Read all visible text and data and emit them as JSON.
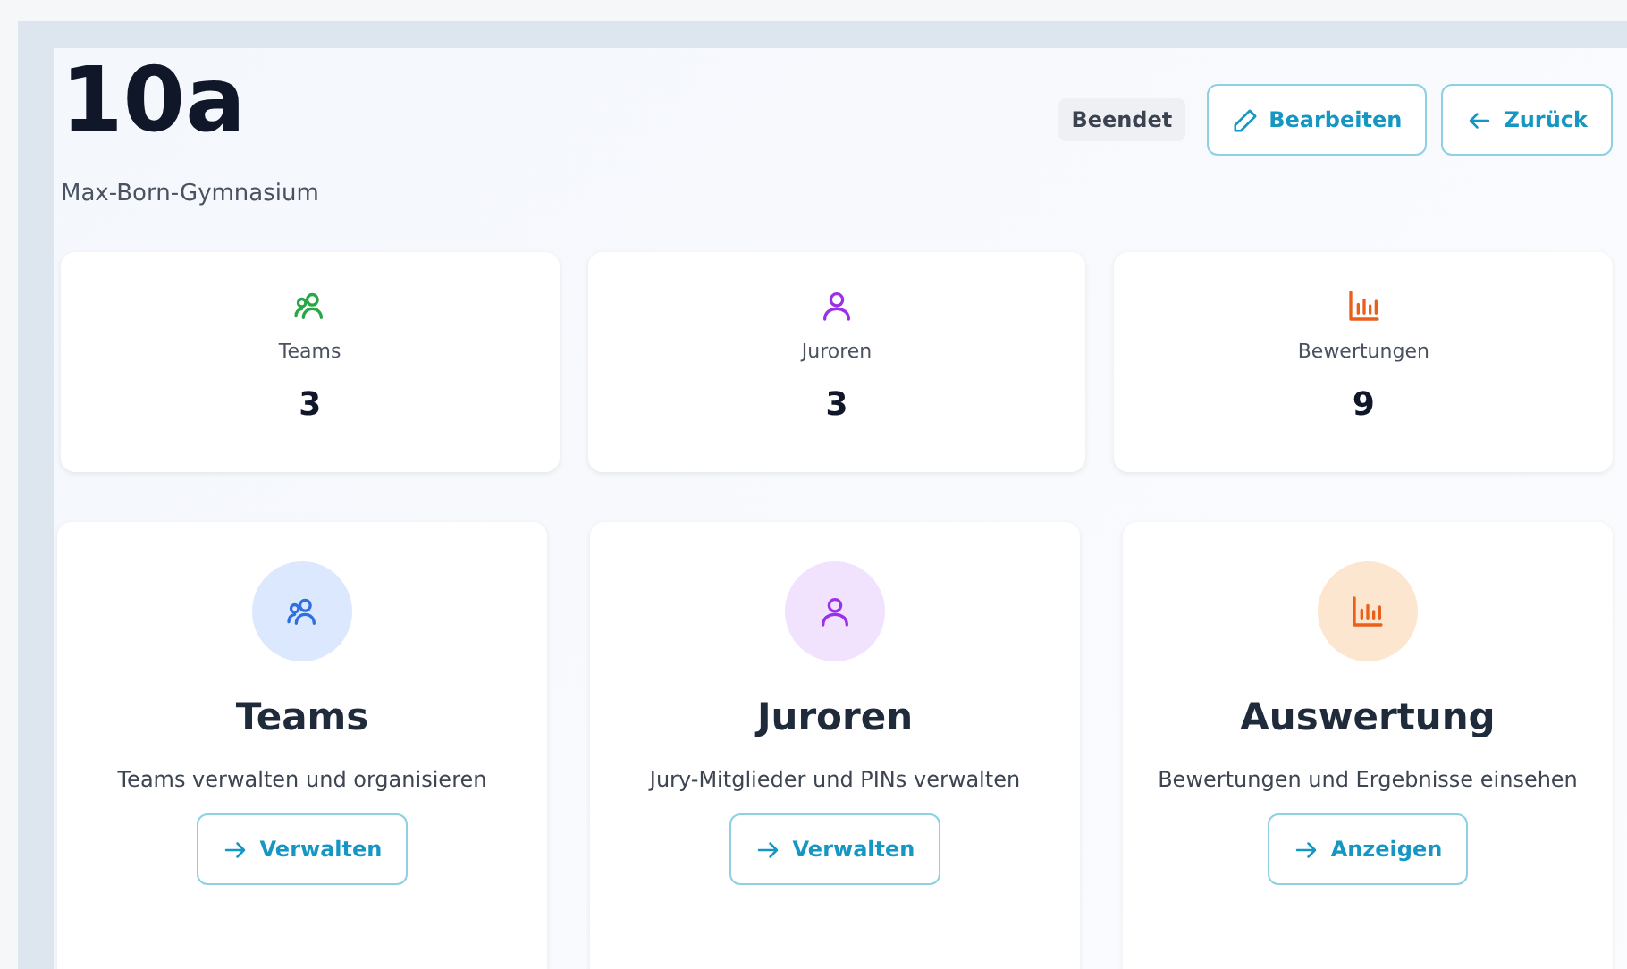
{
  "header": {
    "title": "10a",
    "subtitle": "Max-Born-Gymnasium",
    "status_badge": "Beendet",
    "buttons": [
      {
        "kind": "edit",
        "label": "Bearbeiten"
      },
      {
        "kind": "back",
        "label": "Zurück"
      }
    ]
  },
  "stats": [
    {
      "label": "Teams",
      "value": "3"
    },
    {
      "label": "Juroren",
      "value": "3"
    },
    {
      "label": "Bewertungen",
      "value": "9"
    }
  ],
  "actions": [
    {
      "title": "Teams",
      "description": "Teams verwalten und organisieren",
      "button": "Verwalten"
    },
    {
      "title": "Juroren",
      "description": "Jury-Mitglieder und PINs verwalten",
      "button": "Verwalten"
    },
    {
      "title": "Auswertung",
      "description": "Bewertungen und Ergebnisse einsehen",
      "button": "Anzeigen"
    }
  ]
}
